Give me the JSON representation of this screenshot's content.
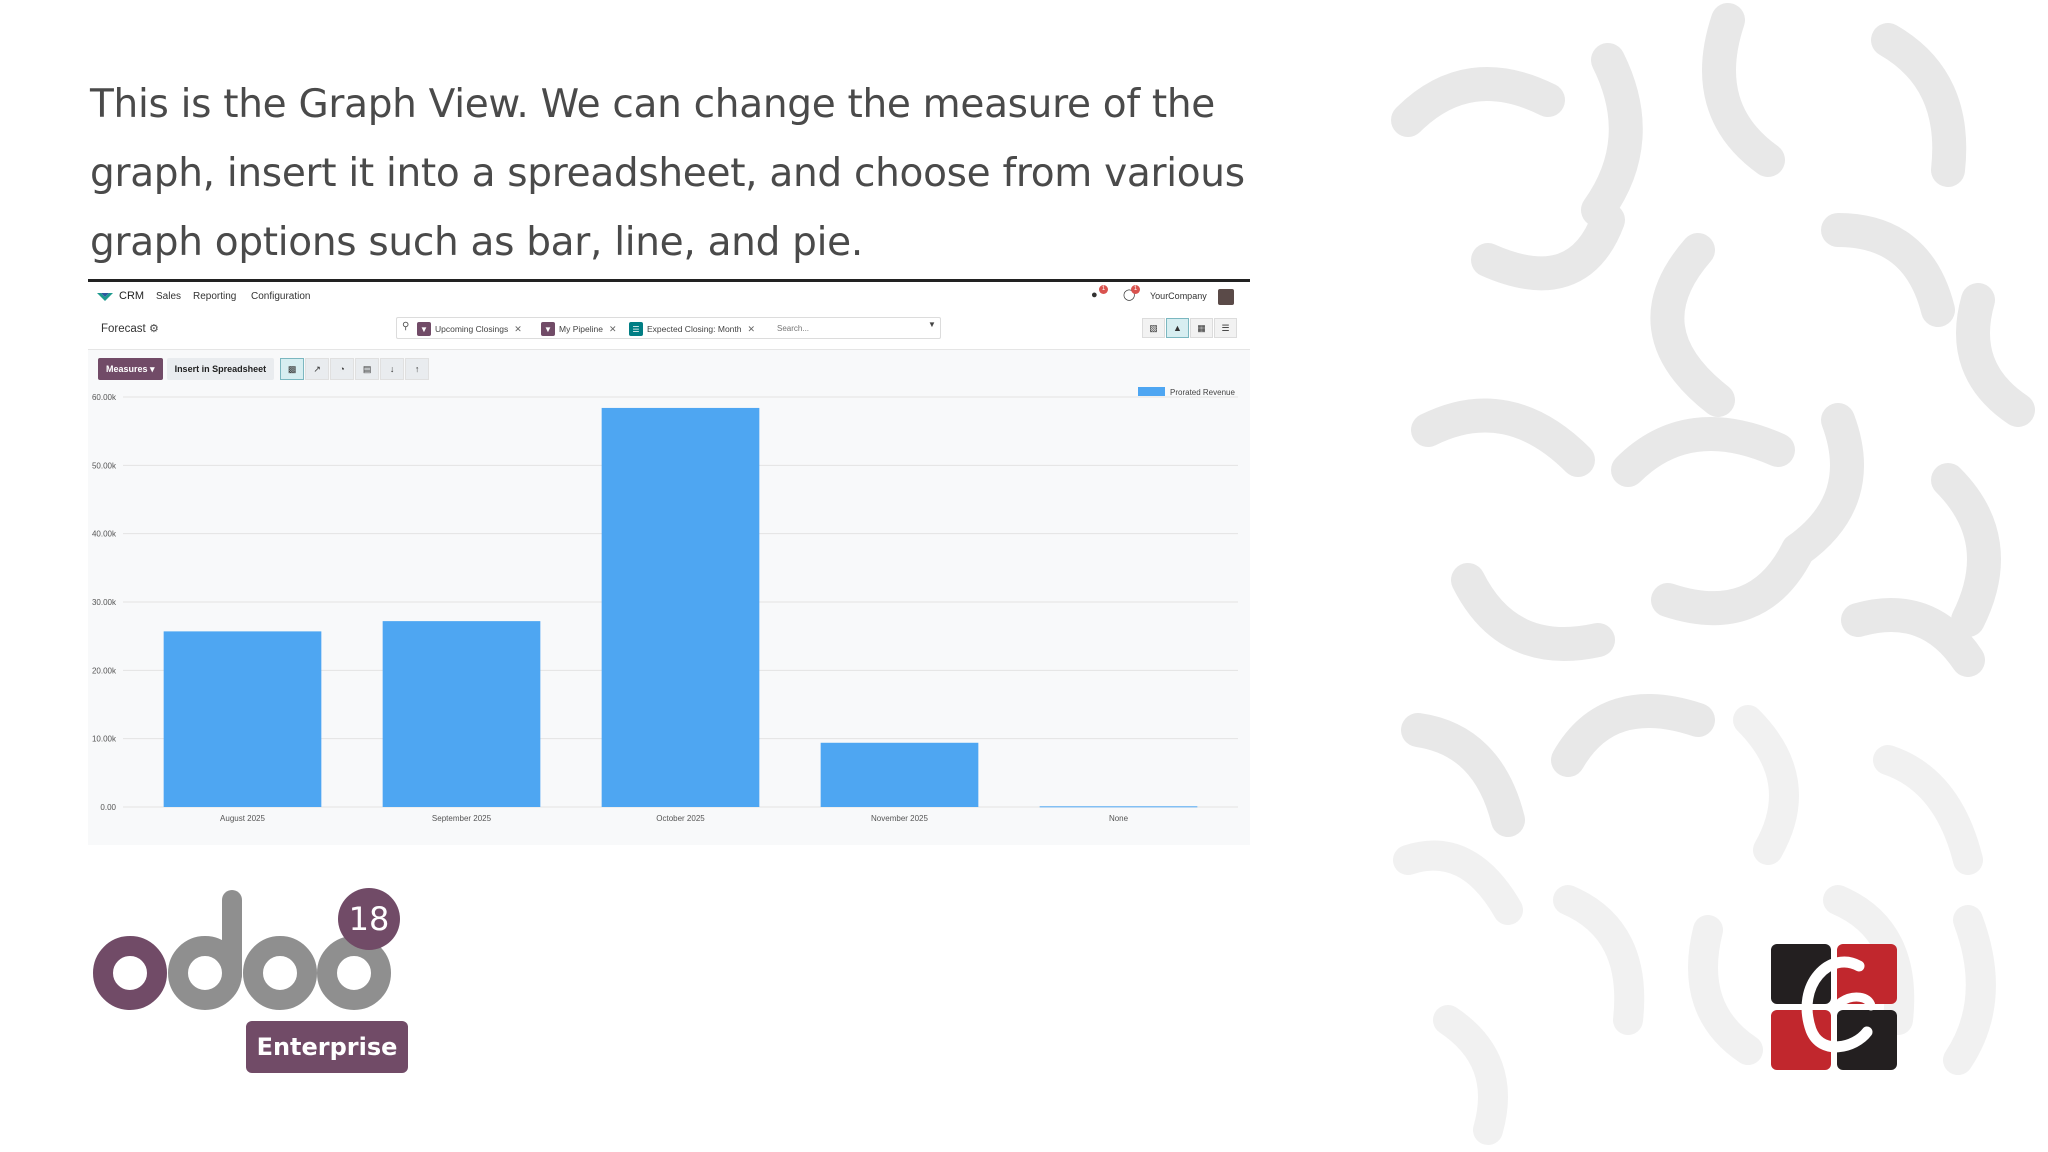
{
  "slide": {
    "headline": "This is the Graph View. We can change the measure of the graph, insert it into a spreadsheet, and choose from various graph options such as bar, line, and pie."
  },
  "navbar": {
    "app_name": "CRM",
    "menus": [
      "Sales",
      "Reporting",
      "Configuration"
    ],
    "company": "YourCompany",
    "messages_badge": "1",
    "activities_badge": "1"
  },
  "control_panel": {
    "title": "Forecast",
    "search": {
      "facets": [
        {
          "label": "Upcoming Closings",
          "icon": "filter-icon",
          "color": "#714b67"
        },
        {
          "label": "My Pipeline",
          "icon": "filter-icon",
          "color": "#714b67"
        },
        {
          "label": "Expected Closing: Month",
          "icon": "group-by-icon",
          "color": "#017e84"
        }
      ],
      "placeholder": "Search..."
    },
    "views": [
      "kanban-view",
      "graph-view",
      "pivot-view",
      "list-view"
    ],
    "active_view": "graph-view"
  },
  "toolbar": {
    "measures_label": "Measures",
    "insert_label": "Insert in Spreadsheet",
    "chart_types": [
      "bar-chart-icon",
      "line-chart-icon",
      "pie-chart-icon",
      "stacked-icon",
      "descending-icon",
      "ascending-icon"
    ],
    "active_chart_type": "bar"
  },
  "chart_data": {
    "type": "bar",
    "categories": [
      "August 2025",
      "September 2025",
      "October 2025",
      "November 2025",
      "None"
    ],
    "series": [
      {
        "name": "Prorated Revenue",
        "values": [
          25700,
          27200,
          58400,
          9400,
          100
        ],
        "color": "#4ea6f2"
      }
    ],
    "ylim": [
      0,
      60000
    ],
    "yticks": [
      0,
      10000,
      20000,
      30000,
      40000,
      50000,
      60000
    ],
    "ytick_labels": [
      "0.00",
      "10.00k",
      "20.00k",
      "30.00k",
      "40.00k",
      "50.00k",
      "60.00k"
    ],
    "legend_position": "top-right",
    "grid": true
  },
  "branding": {
    "product": "odoo",
    "version": "18",
    "edition": "Enterprise",
    "brand_color": "#714b67"
  }
}
